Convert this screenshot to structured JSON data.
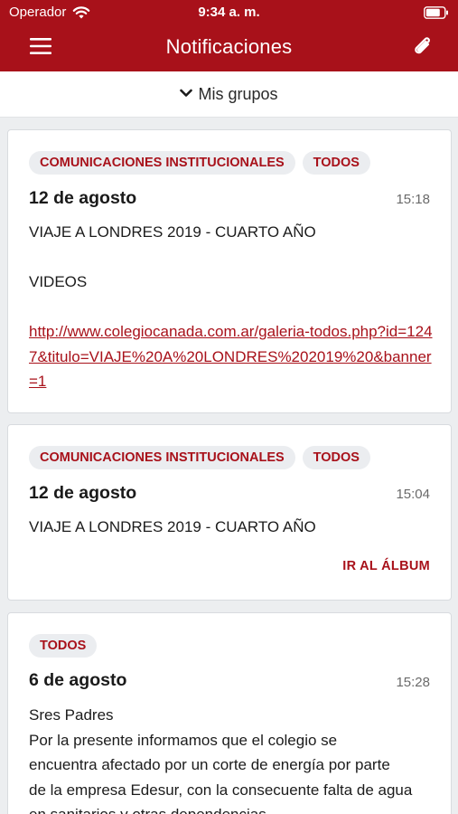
{
  "status_bar": {
    "carrier": "Operador",
    "time": "9:34 a. m."
  },
  "navbar": {
    "title": "Notificaciones",
    "menu_icon": "hamburger-icon",
    "attach_icon": "paperclip-icon"
  },
  "groups": {
    "label": "Mis grupos",
    "icon": "chevron-down-icon"
  },
  "colors": {
    "brand": "#a8111a",
    "tag_bg": "#ebedf0",
    "page_bg": "#eceef0"
  },
  "notifications": [
    {
      "tags": [
        "COMUNICACIONES INSTITUCIONALES",
        "TODOS"
      ],
      "date": "12 de agosto",
      "time": "15:18",
      "title": "VIAJE A LONDRES 2019 - CUARTO AÑO",
      "body": "VIDEOS",
      "link": "http://www.colegiocanada.com.ar/galeria-todos.php?id=1247&titulo=VIAJE%20A%20LONDRES%202019%20&banner=1"
    },
    {
      "tags": [
        "COMUNICACIONES INSTITUCIONALES",
        "TODOS"
      ],
      "date": "12 de agosto",
      "time": "15:04",
      "title": "VIAJE A LONDRES 2019 - CUARTO AÑO",
      "action": "IR AL ÁLBUM"
    },
    {
      "tags": [
        "TODOS"
      ],
      "date": "6 de agosto",
      "time": "15:28",
      "lines": [
        "Sres Padres",
        "Por la presente informamos que el colegio se",
        "encuentra afectado por un corte de energía por parte",
        "de la empresa Edesur, con la consecuente falta de agua",
        "en sanitarios y otras dependencias."
      ]
    }
  ]
}
